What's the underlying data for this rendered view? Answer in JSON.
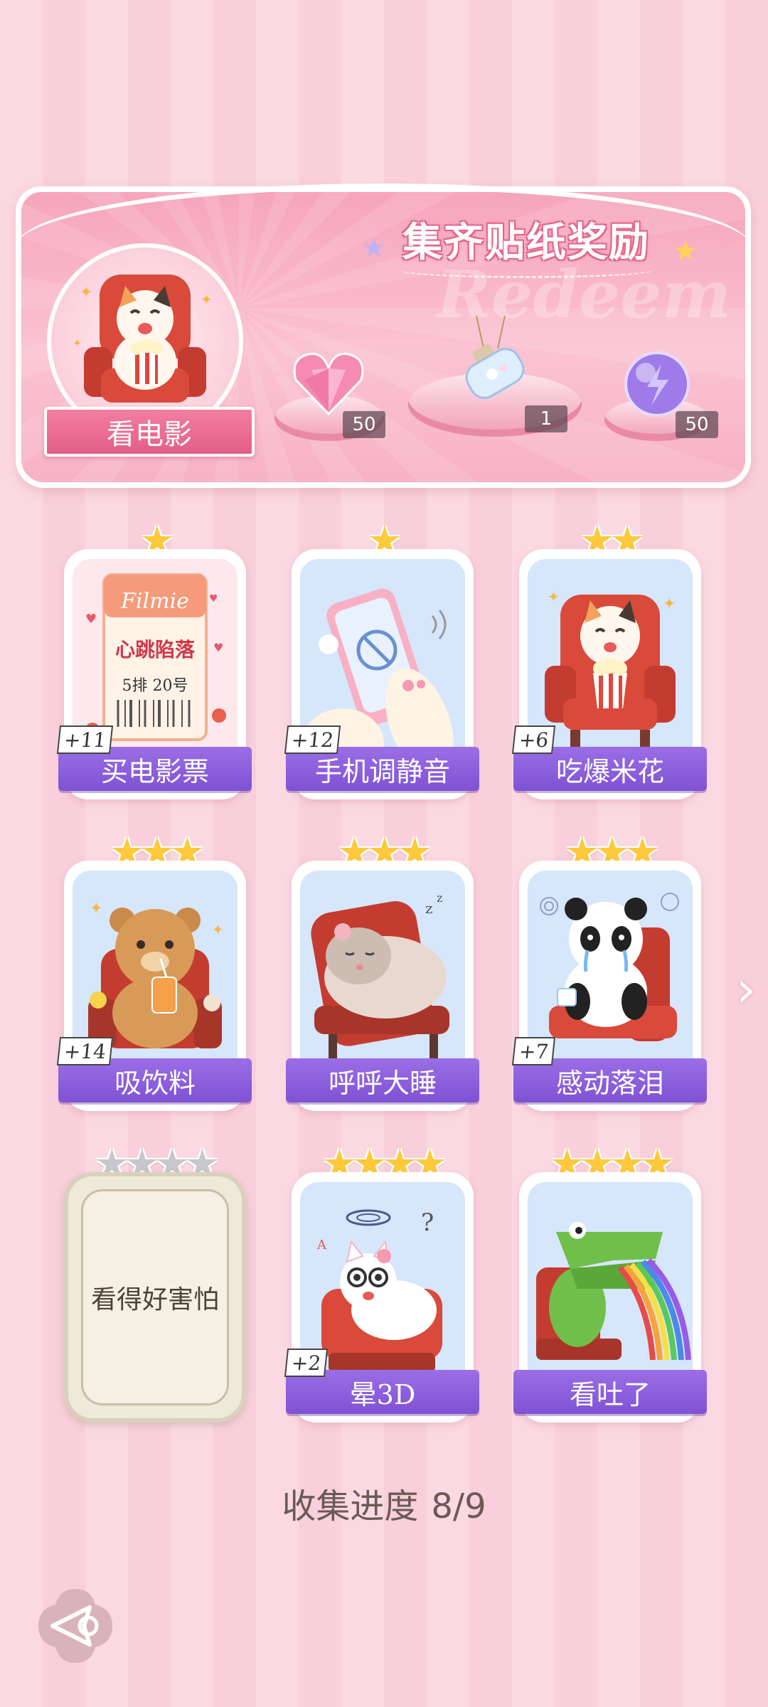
{
  "banner": {
    "title": "集齐贴纸奖励",
    "watermark": "Redeem",
    "theme_label": "看电影",
    "rewards": [
      {
        "icon": "pink-heart-gem-icon",
        "count": "50"
      },
      {
        "icon": "bottle-pendant-icon",
        "count": "1"
      },
      {
        "icon": "lightning-orb-icon",
        "count": "50"
      }
    ]
  },
  "stickers": [
    {
      "label": "买电影票",
      "plus": "+11",
      "stars": 1,
      "max_stars": 1,
      "collected": true,
      "art": "movie-ticket",
      "ticket": {
        "brand": "Filmie",
        "title": "心跳陷落",
        "seat": "5排 20号"
      }
    },
    {
      "label": "手机调静音",
      "plus": "+12",
      "stars": 1,
      "max_stars": 1,
      "collected": true,
      "art": "phone-mute"
    },
    {
      "label": "吃爆米花",
      "plus": "+6",
      "stars": 2,
      "max_stars": 2,
      "collected": true,
      "art": "cat-popcorn"
    },
    {
      "label": "吸饮料",
      "plus": "+14",
      "stars": 3,
      "max_stars": 3,
      "collected": true,
      "art": "bear-drink"
    },
    {
      "label": "呼呼大睡",
      "plus": "",
      "stars": 3,
      "max_stars": 3,
      "collected": true,
      "art": "hamster-sleep"
    },
    {
      "label": "感动落泪",
      "plus": "+7",
      "stars": 3,
      "max_stars": 3,
      "collected": true,
      "art": "panda-cry"
    },
    {
      "label": "看得好害怕",
      "plus": "",
      "stars": 0,
      "max_stars": 4,
      "collected": false,
      "art": "locked"
    },
    {
      "label": "晕3D",
      "plus": "+2",
      "stars": 4,
      "max_stars": 4,
      "collected": true,
      "art": "cat-dizzy"
    },
    {
      "label": "看吐了",
      "plus": "",
      "stars": 4,
      "max_stars": 4,
      "collected": true,
      "art": "croc-rainbow"
    }
  ],
  "progress": {
    "label": "收集进度",
    "value": "8/9"
  },
  "colors": {
    "accent_purple": "#8a5ddd",
    "star_gold": "#ffc93c",
    "banner_pink": "#f6a5bb"
  }
}
